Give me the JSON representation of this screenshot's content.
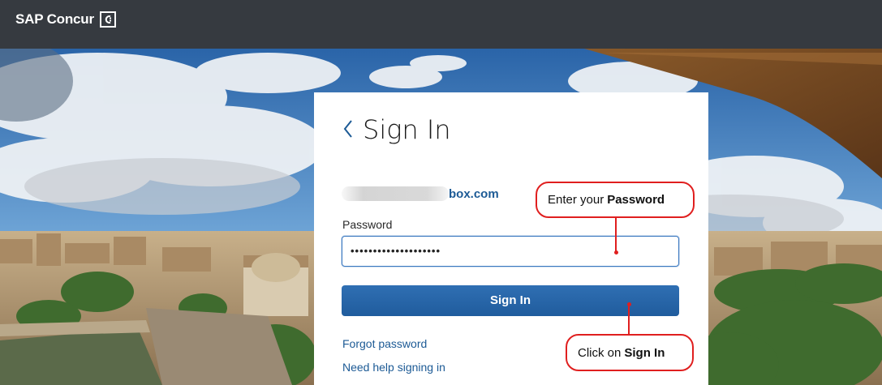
{
  "header": {
    "brand_name": "SAP Concur",
    "logo_icon": "concur-c-logo-icon",
    "background": "#363a40"
  },
  "card": {
    "title": "Sign In",
    "back_icon": "chevron-left-icon",
    "email_domain": "box.com",
    "password_label": "Password",
    "password_value": "••••••••••••••••••••",
    "signin_label": "Sign In",
    "forgot_link": "Forgot password",
    "help_link": "Need help signing in",
    "accent_color": "#1c5a95"
  },
  "annotations": {
    "password_prefix": "Enter your",
    "password_bold": "Password",
    "signin_prefix": "Click on",
    "signin_bold": "Sign In",
    "color": "#e01f1f"
  }
}
